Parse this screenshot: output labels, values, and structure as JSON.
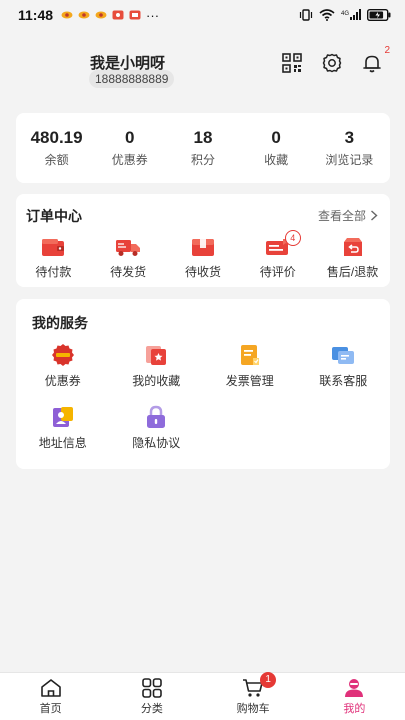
{
  "status_bar": {
    "time": "11:48",
    "more": "···",
    "battery_level": 0.85
  },
  "profile": {
    "name": "我是小明呀",
    "phone": "18888888889",
    "bell_badge": "2"
  },
  "stats": [
    {
      "value": "480.19",
      "label": "余额"
    },
    {
      "value": "0",
      "label": "优惠券"
    },
    {
      "value": "18",
      "label": "积分"
    },
    {
      "value": "0",
      "label": "收藏"
    },
    {
      "value": "3",
      "label": "浏览记录"
    }
  ],
  "orders": {
    "title": "订单中心",
    "view_all": "查看全部",
    "items": [
      {
        "label": "待付款",
        "icon": "wallet-icon"
      },
      {
        "label": "待发货",
        "icon": "truck-icon"
      },
      {
        "label": "待收货",
        "icon": "package-icon"
      },
      {
        "label": "待评价",
        "icon": "review-icon",
        "badge": "4"
      },
      {
        "label": "售后/退款",
        "icon": "refund-icon"
      }
    ]
  },
  "services": {
    "title": "我的服务",
    "items": [
      {
        "label": "优惠券",
        "icon": "coupon-icon"
      },
      {
        "label": "我的收藏",
        "icon": "favorite-icon"
      },
      {
        "label": "发票管理",
        "icon": "invoice-icon"
      },
      {
        "label": "联系客服",
        "icon": "customer-service-icon"
      },
      {
        "label": "地址信息",
        "icon": "address-icon"
      },
      {
        "label": "隐私协议",
        "icon": "privacy-lock-icon"
      }
    ]
  },
  "tabbar": {
    "items": [
      {
        "label": "首页",
        "icon": "home-icon"
      },
      {
        "label": "分类",
        "icon": "category-icon"
      },
      {
        "label": "购物车",
        "icon": "cart-icon",
        "badge": "1"
      },
      {
        "label": "我的",
        "icon": "user-icon",
        "active": true
      }
    ]
  },
  "colors": {
    "accent_red": "#e53935",
    "active_tab": "#e0317a",
    "background": "#f3f3f3"
  }
}
